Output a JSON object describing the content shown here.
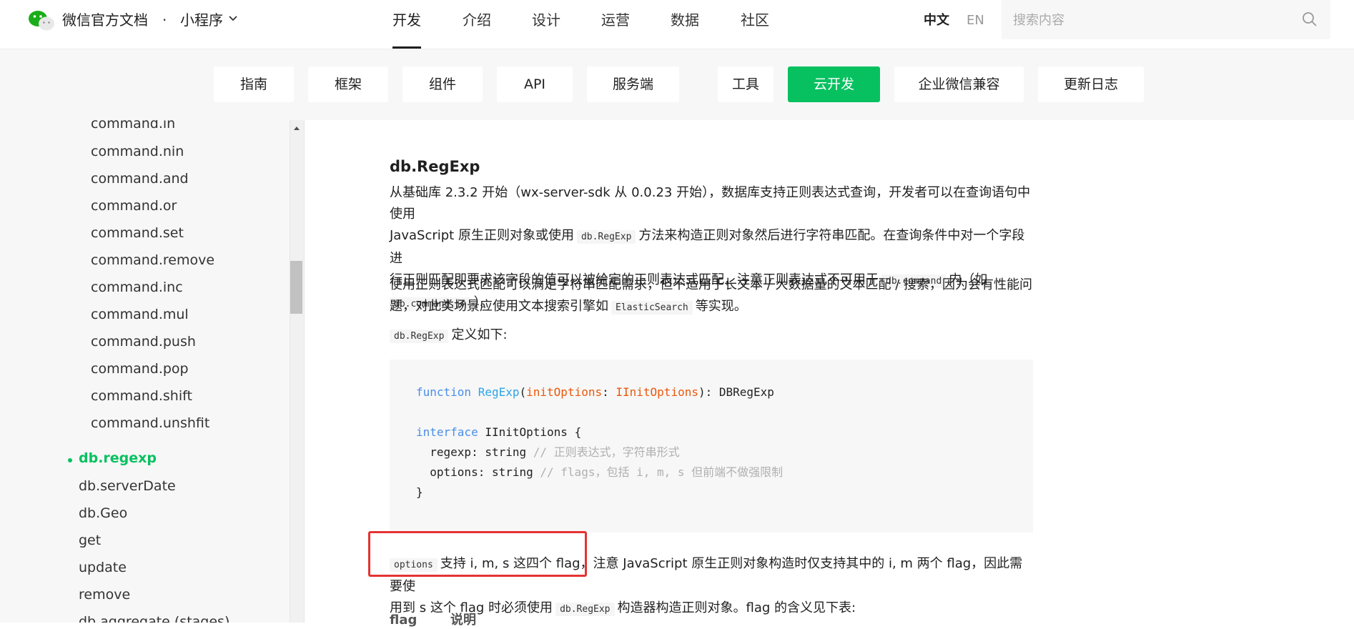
{
  "header": {
    "brand": "微信官方文档",
    "dot": "·",
    "product": "小程序",
    "nav": [
      "开发",
      "介绍",
      "设计",
      "运营",
      "数据",
      "社区"
    ],
    "active_nav": "开发",
    "lang_zh": "中文",
    "lang_en": "EN",
    "search_placeholder": "搜索内容"
  },
  "categories": [
    "指南",
    "框架",
    "组件",
    "API",
    "服务端",
    "工具",
    "云开发",
    "企业微信兼容",
    "更新日志"
  ],
  "active_category": "云开发",
  "sidebar": {
    "items": [
      "command.in",
      "command.nin",
      "command.and",
      "command.or",
      "command.set",
      "command.remove",
      "command.inc",
      "command.mul",
      "command.push",
      "command.pop",
      "command.shift",
      "command.unshfit",
      "db.regexp",
      "db.serverDate",
      "db.Geo",
      "get",
      "update",
      "remove",
      "db.aggregate (stages)"
    ],
    "active_item": "db.regexp"
  },
  "content": {
    "title": "db.RegExp",
    "p1": {
      "t1": "从基础库 2.3.2 开始（wx-server-sdk 从 0.0.23 开始），数据库支持正则表达式查询，开发者可以在查询语句中使用",
      "t2": "JavaScript 原生正则对象或使用",
      "c1": "db.RegExp",
      "t3": "方法来构造正则对象然后进行字符串匹配。在查询条件中对一个字段进",
      "t4": "行正则匹配即要求该字段的值可以被给定的正则表达式匹配，注意正则表达式不可用于",
      "c2": "db.command",
      "t5": "内（如",
      "c3": "db.command.in",
      "t6": "）。"
    },
    "p2": {
      "t1": "使用正则表达式匹配可以满足字符串匹配需求，但不适用于长文本 / 大数据量的文本匹配 / 搜索，因为会有性能问",
      "t2": "题，对此类场景应使用文本搜索引擎如",
      "c1": "ElasticSearch",
      "t3": "等实现。"
    },
    "p3": {
      "c1": "db.RegExp",
      "t1": "定义如下:"
    },
    "code": {
      "l1_kw": "function",
      "l1_fn": "RegExp",
      "l1_open": "(",
      "l1_param": "initOptions",
      "l1_colon": ": ",
      "l1_type": "IInitOptions",
      "l1_rest": "): DBRegExp",
      "l2_kw": "interface",
      "l2_rest": " IInitOptions {",
      "l3_code": "  regexp: string ",
      "l3_comment": "// 正则表达式，字符串形式",
      "l4_code": "  options: string ",
      "l4_comment": "// flags，包括 i, m, s 但前端不做强限制",
      "l5": "}"
    },
    "p4": {
      "c1": "options",
      "t1": "支持 i, m, s 这四个 flag，注意 JavaScript 原生正则对象构造时仅支持其中的 i, m 两个 flag，因此需要使",
      "t2": "用到 s 这个 flag 时必须使用",
      "c2": "db.RegExp",
      "t3": "构造器构造正则对象。flag 的含义见下表:"
    },
    "table_headers": [
      "flag",
      "说明"
    ]
  }
}
